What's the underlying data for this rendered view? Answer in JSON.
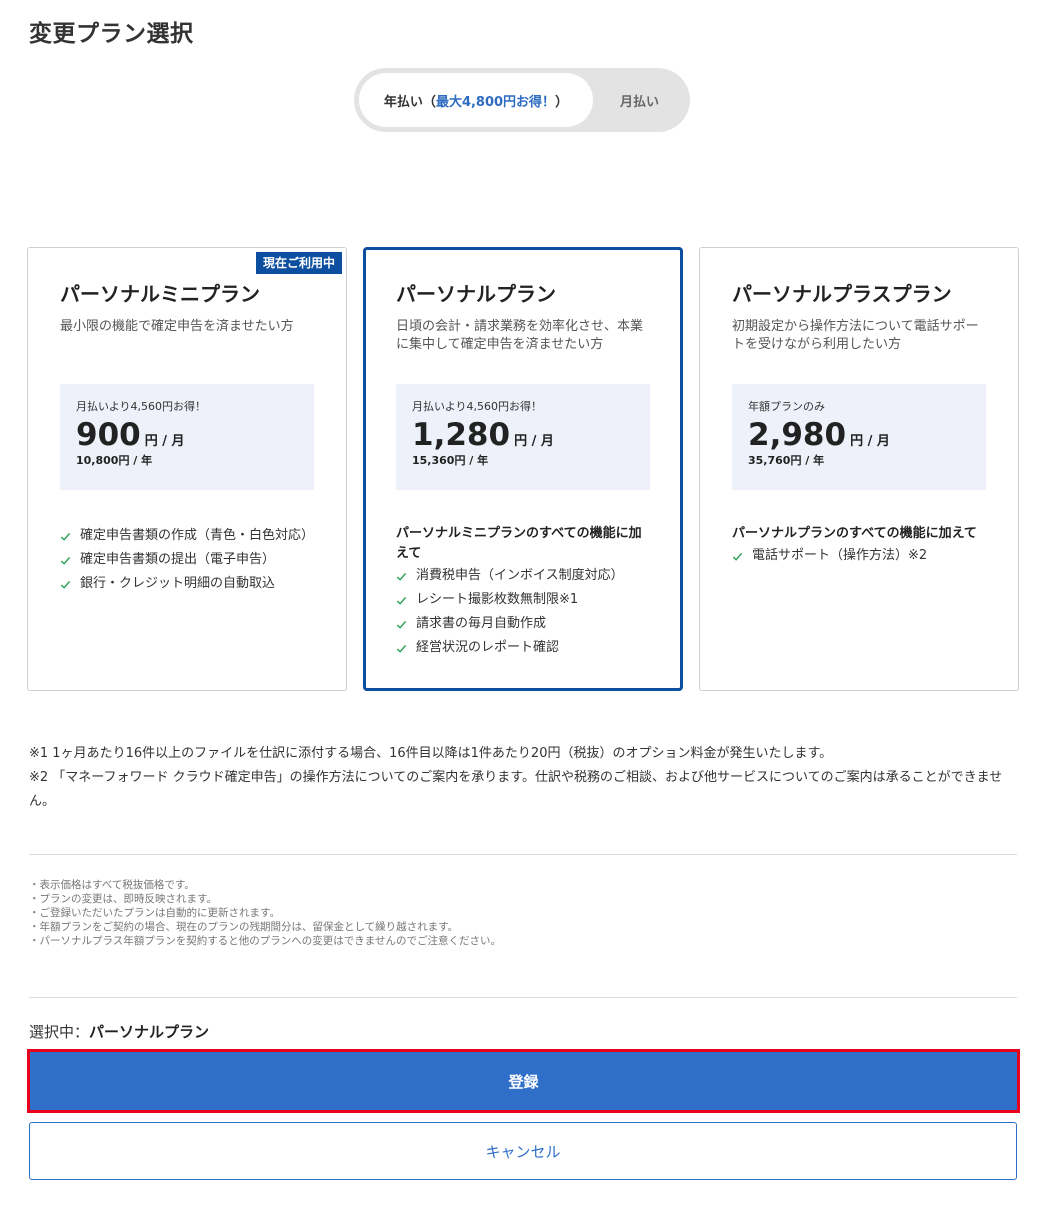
{
  "page_title": "変更プラン選択",
  "billing_toggle": {
    "yearly_label": "年払い（",
    "yearly_accent": "最大4,800円お得！",
    "yearly_suffix": "）",
    "monthly_label": "月払い"
  },
  "plans": [
    {
      "name": "パーソナルミニプラン",
      "badge": "現在ご利用中",
      "description": "最小限の機能で確定申告を済ませたい方",
      "price_note": "月払いより4,560円お得！",
      "price": "900",
      "price_unit": "円 / 月",
      "price_year": "10,800円 / 年",
      "features_heading": "",
      "features": [
        "確定申告書類の作成（青色・白色対応）",
        "確定申告書類の提出（電子申告）",
        "銀行・クレジット明細の自動取込"
      ]
    },
    {
      "name": "パーソナルプラン",
      "description": "日頃の会計・請求業務を効率化させ、本業に集中して確定申告を済ませたい方",
      "price_note": "月払いより4,560円お得！",
      "price": "1,280",
      "price_unit": "円 / 月",
      "price_year": "15,360円 / 年",
      "features_heading": "パーソナルミニプランのすべての機能に加えて",
      "features": [
        "消費税申告（インボイス制度対応）",
        "レシート撮影枚数無制限※1",
        "請求書の毎月自動作成",
        "経営状況のレポート確認"
      ]
    },
    {
      "name": "パーソナルプラスプラン",
      "description": "初期設定から操作方法について電話サポートを受けながら利用したい方",
      "price_note": "年額プランのみ",
      "price": "2,980",
      "price_unit": "円 / 月",
      "price_year": "35,760円 / 年",
      "features_heading": "パーソナルプランのすべての機能に加えて",
      "features": [
        "電話サポート（操作方法）※2"
      ]
    }
  ],
  "footnotes": [
    "※1 1ヶ月あたり16件以上のファイルを仕訳に添付する場合、16件目以降は1件あたり20円（税抜）のオプション料金が発生いたします。",
    "※2 「マネーフォワード クラウド確定申告」の操作方法についてのご案内を承ります。仕訳や税務のご相談、および他サービスについてのご案内は承ることができません。"
  ],
  "notes": [
    "・表示価格はすべて税抜価格です。",
    "・プランの変更は、即時反映されます。",
    "・ご登録いただいたプランは自動的に更新されます。",
    "・年額プランをご契約の場合、現在のプランの残期間分は、留保金として繰り越されます。",
    "・パーソナルプラス年額プランを契約すると他のプランへの変更はできませんのでご注意ください。"
  ],
  "selection": {
    "label": "選択中：",
    "value": "パーソナルプラン"
  },
  "buttons": {
    "register": "登録",
    "cancel": "キャンセル"
  },
  "colors": {
    "primary": "#2f6fc9",
    "selected_border": "#0c4fa1",
    "highlight_border": "#e8001c",
    "check": "#2e9e5b"
  },
  "icons": {
    "feature_bullet": "check-icon"
  }
}
